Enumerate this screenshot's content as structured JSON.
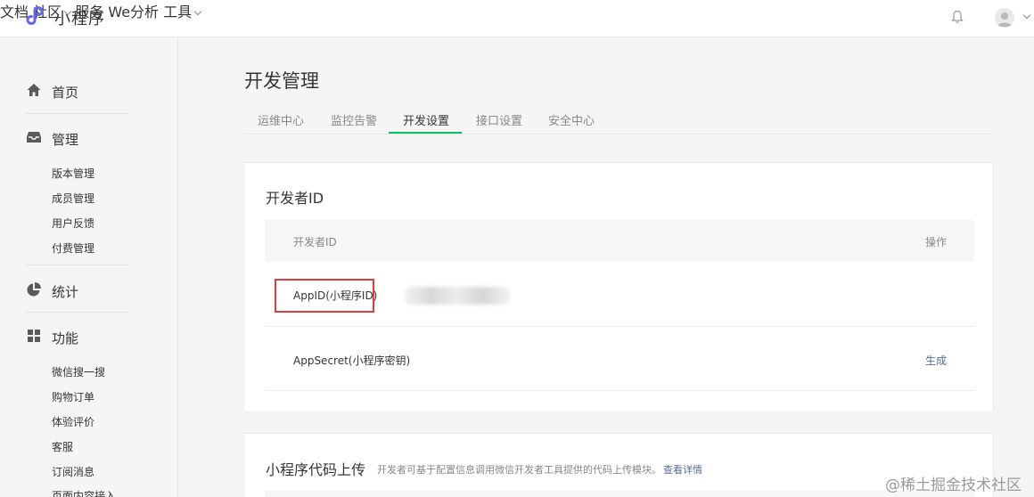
{
  "header": {
    "brand_name": "小程序",
    "nav": {
      "docs": "文档",
      "community": "社区",
      "services": "服务",
      "weanalysis": "We分析",
      "tools": "工具"
    }
  },
  "sidebar": {
    "home": "首页",
    "manage": "管理",
    "manage_items": [
      "版本管理",
      "成员管理",
      "用户反馈",
      "付费管理"
    ],
    "stats": "统计",
    "features": "功能",
    "feature_items": [
      "微信搜一搜",
      "购物订单",
      "体验评价",
      "客服",
      "订阅消息",
      "页面内容接入"
    ]
  },
  "main": {
    "title": "开发管理",
    "tabs": [
      "运维中心",
      "监控告警",
      "开发设置",
      "接口设置",
      "安全中心"
    ],
    "active_tab": "开发设置",
    "developer_id": {
      "title": "开发者ID",
      "col_id": "开发者ID",
      "col_action": "操作",
      "appid_label": "AppID(小程序ID)",
      "appsecret_label": "AppSecret(小程序密钥)",
      "appsecret_action": "生成"
    },
    "code_upload": {
      "title": "小程序代码上传",
      "description": "开发者可基于配置信息调用微信开发者工具提供的代码上传模块。",
      "details_link": "查看详情"
    }
  },
  "watermark": "@稀土掘金技术社区",
  "colors": {
    "accent_green": "#07c160",
    "link_blue": "#576b95",
    "highlight_red": "#e13b3b",
    "brand_purple": "#6467f0"
  },
  "icons": {
    "brand": "miniprogram-logo-icon",
    "bell": "bell-icon",
    "home": "home-icon",
    "manage": "inbox-icon",
    "stats": "pie-chart-icon",
    "features": "grid-icon"
  }
}
